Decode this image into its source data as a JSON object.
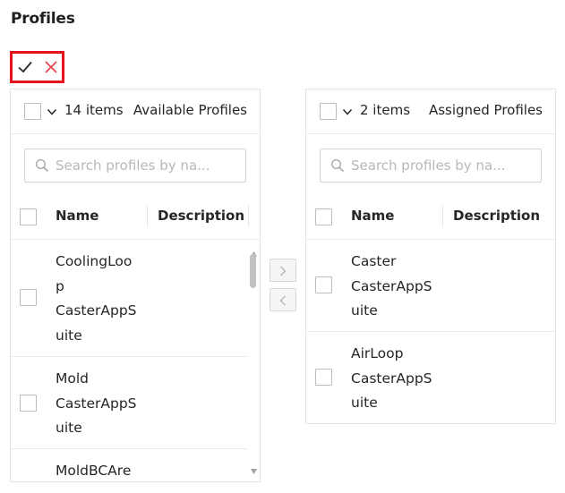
{
  "page": {
    "title": "Profiles"
  },
  "actions": {
    "confirm_icon": "check-icon",
    "cancel_icon": "close-icon"
  },
  "colors": {
    "accent_red": "#e5121d",
    "border": "#e4e4e4",
    "placeholder": "#b8b8b8"
  },
  "available": {
    "count": "14 items",
    "title": "Available Profiles",
    "search_placeholder": "Search profiles by na...",
    "columns": {
      "name": "Name",
      "description": "Description"
    },
    "rows": [
      {
        "lines": [
          "CoolingLoo",
          "p",
          "CasterAppS",
          "uite"
        ]
      },
      {
        "lines": [
          "Mold",
          "CasterAppS",
          "uite"
        ]
      },
      {
        "lines": [
          "MoldBCAre"
        ]
      }
    ]
  },
  "assigned": {
    "count": "2 items",
    "title": "Assigned Profiles",
    "search_placeholder": "Search profiles by na...",
    "columns": {
      "name": "Name",
      "description": "Description"
    },
    "rows": [
      {
        "lines": [
          "Caster",
          "CasterAppS",
          "uite"
        ]
      },
      {
        "lines": [
          "AirLoop",
          "CasterAppS",
          "uite"
        ]
      }
    ]
  },
  "transfer": {
    "move_right_icon": "chevron-right-icon",
    "move_left_icon": "chevron-left-icon"
  }
}
